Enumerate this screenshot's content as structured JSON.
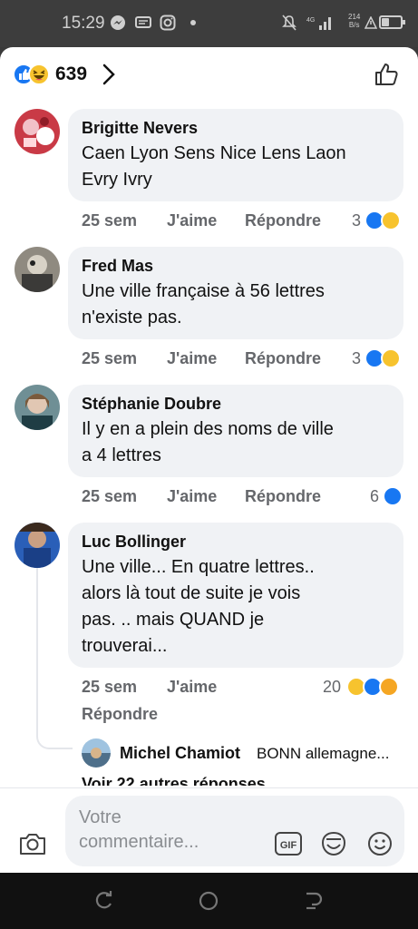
{
  "status_bar": {
    "time": "15:29",
    "network_top": "4G",
    "network_speed": "214",
    "network_unit": "B/s"
  },
  "header": {
    "reaction_count": "639",
    "reaction_icons": [
      "like-icon",
      "haha-icon"
    ]
  },
  "comments": [
    {
      "author": "Brigitte Nevers",
      "text_lines": [
        "Caen Lyon Sens Nice Lens Laon",
        "Evry Ivry"
      ],
      "time": "25 sem",
      "like_label": "J'aime",
      "reply_label": "Répondre",
      "reaction_count": "3",
      "reaction_icons": [
        "like-icon",
        "haha-icon"
      ]
    },
    {
      "author": "Fred Mas",
      "text_lines": [
        "Une ville française à 56 lettres",
        "n'existe pas."
      ],
      "time": "25 sem",
      "like_label": "J'aime",
      "reply_label": "Répondre",
      "reaction_count": "3",
      "reaction_icons": [
        "like-icon",
        "haha-icon"
      ]
    },
    {
      "author": "Stéphanie Doubre",
      "text_lines": [
        "Il y en a plein des noms de ville",
        "a 4 lettres"
      ],
      "time": "25 sem",
      "like_label": "J'aime",
      "reply_label": "Répondre",
      "reaction_count": "6",
      "reaction_icons": [
        "like-icon"
      ]
    },
    {
      "author": "Luc Bollinger",
      "text_lines": [
        "Une ville... En quatre lettres..",
        "alors là tout de suite je vois",
        "pas. .. mais QUAND je",
        "trouverai..."
      ],
      "time": "25 sem",
      "like_label": "J'aime",
      "reply_label": "Répondre",
      "reaction_count": "20",
      "reaction_icons": [
        "haha-icon",
        "like-icon",
        "love-icon"
      ]
    }
  ],
  "reply_preview": {
    "author": "Michel Chamiot",
    "text": "BONN  allemagne..."
  },
  "more_replies": "Voir 22 autres réponses",
  "composer": {
    "placeholder_line1": "Votre",
    "placeholder_line2": "commentaire..."
  },
  "colors": {
    "like_blue": "#1877f2",
    "haha_yellow": "#f7c32e",
    "bubble_bg": "#f0f2f5",
    "meta_gray": "#65676b"
  }
}
